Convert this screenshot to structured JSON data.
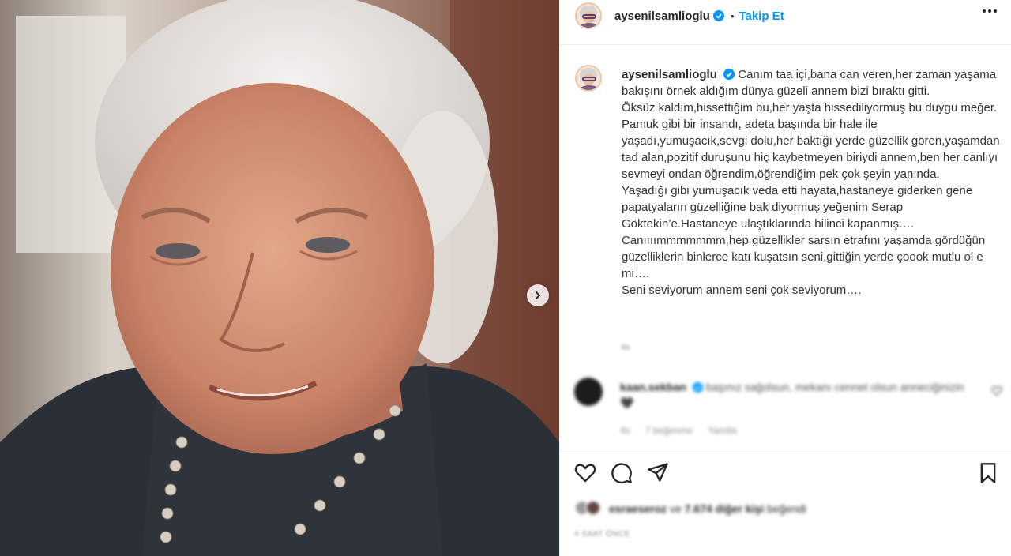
{
  "post": {
    "author": {
      "username": "aysenilsamlioglu",
      "verified": true,
      "follow_separator": "•",
      "follow_label": "Takip Et"
    },
    "caption": {
      "text": "Canım taa içi,bana can veren,her zaman yaşama bakışını örnek aldığım dünya güzeli annem bizi bıraktı gitti.\nÖksüz kaldım,hissettiğim bu,her yaşta hissediliyormuş bu duygu meğer.\nPamuk gibi bir insandı, adeta başında bir hale ile yaşadı,yumuşacık,sevgi dolu,her baktığı yerde güzellik gören,yaşamdan tad alan,pozitif duruşunu hiç kaybetmeyen biriydi annem,ben her canlıyı sevmeyi ondan öğrendim,öğrendiğim pek çok şeyin yanında.\nYaşadığı gibi yumuşacık veda etti hayata,hastaneye giderken gene papatyaların güzelliğine bak diyormuş yeğenim Serap Göktekin’e.Hastaneye ulaştıklarında bilinci kapanmış….\nCanıııımmmmmmm,hep güzellikler sarsın etrafını yaşamda gördüğün güzelliklerin binlerce katı kuşatsın seni,gittiğin yerde çoook mutlu ol e mi….\nSeni seviyorum annem seni çok seviyorum….",
      "age": "4s"
    },
    "comment": {
      "username": "kaan.sekban",
      "verified": true,
      "text": "başınız sağolsun, mekanı cennet olsun anneciğinizin🖤",
      "age": "4s",
      "likes": "7 beğenme",
      "reply_label": "Yanıtla"
    },
    "likes": {
      "first_liker": "esraeseroz",
      "connector": "ve",
      "others": "7.674 diğer kişi",
      "suffix": "beğendi"
    },
    "posted": "4 SAAT ÖNCE",
    "icons": {
      "more": "more-horizontal-icon",
      "like": "heart-icon",
      "comment": "comment-bubble-icon",
      "share": "paper-plane-icon",
      "save": "bookmark-icon",
      "next": "chevron-right-icon",
      "verified": "verified-badge-icon"
    },
    "colors": {
      "accent": "#0095f6",
      "text": "#262626",
      "muted": "#8e8e8e",
      "border": "#efefef"
    }
  }
}
